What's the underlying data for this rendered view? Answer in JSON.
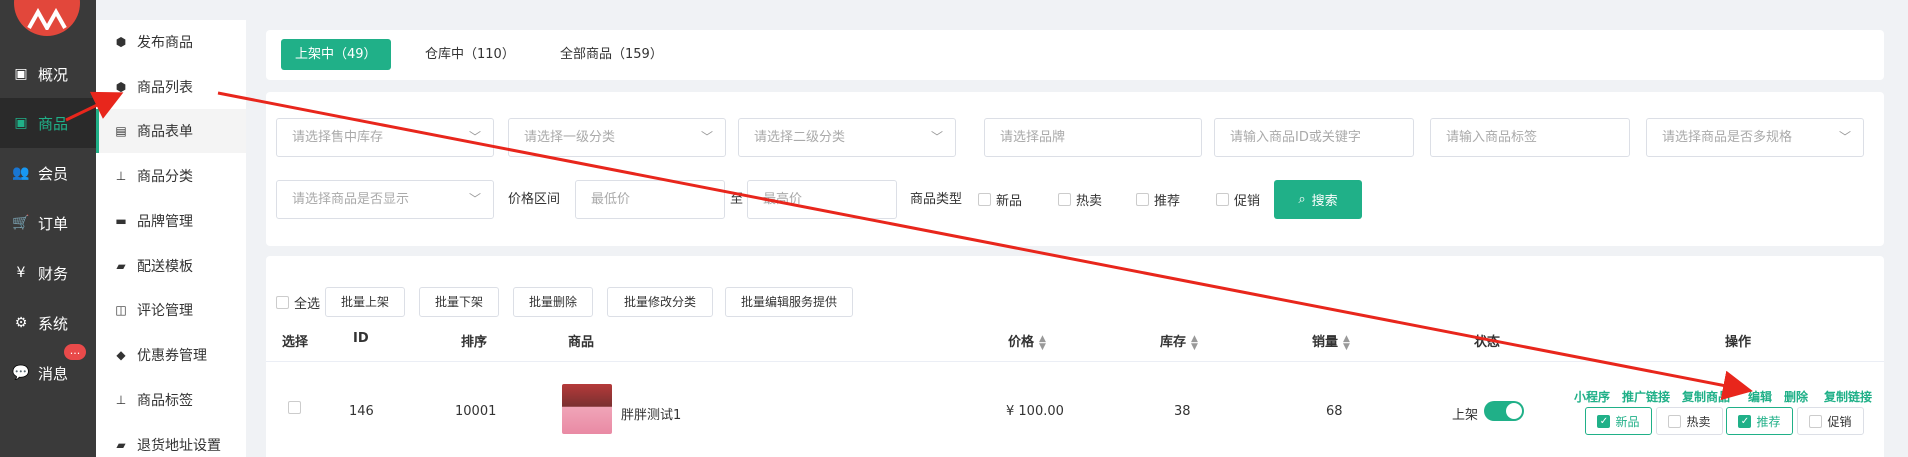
{
  "sidebar": {
    "items": [
      {
        "label": "概况",
        "icon": "box-icon"
      },
      {
        "label": "商品",
        "icon": "product-icon"
      },
      {
        "label": "会员",
        "icon": "users-icon"
      },
      {
        "label": "订单",
        "icon": "cart-icon"
      },
      {
        "label": "财务",
        "icon": "yen-icon"
      },
      {
        "label": "系统",
        "icon": "gear-icon"
      },
      {
        "label": "消息",
        "icon": "chat-icon",
        "badge": "..."
      }
    ]
  },
  "submenu": {
    "items": [
      {
        "label": "发布商品"
      },
      {
        "label": "商品列表"
      },
      {
        "label": "商品表单"
      },
      {
        "label": "商品分类"
      },
      {
        "label": "品牌管理"
      },
      {
        "label": "配送模板"
      },
      {
        "label": "评论管理"
      },
      {
        "label": "优惠券管理"
      },
      {
        "label": "商品标签"
      },
      {
        "label": "退货地址设置"
      }
    ]
  },
  "tabs": [
    {
      "label": "上架中（49）"
    },
    {
      "label": "仓库中（110）"
    },
    {
      "label": "全部商品（159）"
    }
  ],
  "filters": {
    "stock_placeholder": "请选择售中库存",
    "cat1_placeholder": "请选择一级分类",
    "cat2_placeholder": "请选择二级分类",
    "brand_placeholder": "请选择品牌",
    "keyword_placeholder": "请输入商品ID或关键字",
    "tag_placeholder": "请输入商品标签",
    "spec_placeholder": "请选择商品是否多规格",
    "display_placeholder": "请选择商品是否显示",
    "price_label": "价格区间",
    "min_placeholder": "最低价",
    "range_sep": "至",
    "max_placeholder": "最高价",
    "type_label": "商品类型",
    "types": [
      "新品",
      "热卖",
      "推荐",
      "促销"
    ],
    "search_label": "搜索"
  },
  "batch": {
    "select_all": "全选",
    "buttons": [
      "批量上架",
      "批量下架",
      "批量删除",
      "批量修改分类",
      "批量编辑服务提供"
    ]
  },
  "table": {
    "headers": {
      "select": "选择",
      "id": "ID",
      "sort": "排序",
      "product": "商品",
      "price": "价格",
      "stock": "库存",
      "sales": "销量",
      "status": "状态",
      "ops": "操作"
    },
    "row": {
      "id": "146",
      "sort": "10001",
      "name": "胖胖测试1",
      "price": "¥ 100.00",
      "stock": "38",
      "sales": "68",
      "status": "上架",
      "links": [
        "小程序",
        "推广链接",
        "复制商品",
        "编辑",
        "删除",
        "复制链接"
      ],
      "tags": [
        {
          "label": "新品",
          "checked": true
        },
        {
          "label": "热卖",
          "checked": false
        },
        {
          "label": "推荐",
          "checked": true
        },
        {
          "label": "促销",
          "checked": false
        }
      ]
    }
  },
  "colors": {
    "accent": "#20b088",
    "sidebar_dark": "#3a3a3a",
    "logo": "#e2473b",
    "annotation_arrow": "#e8261c"
  }
}
